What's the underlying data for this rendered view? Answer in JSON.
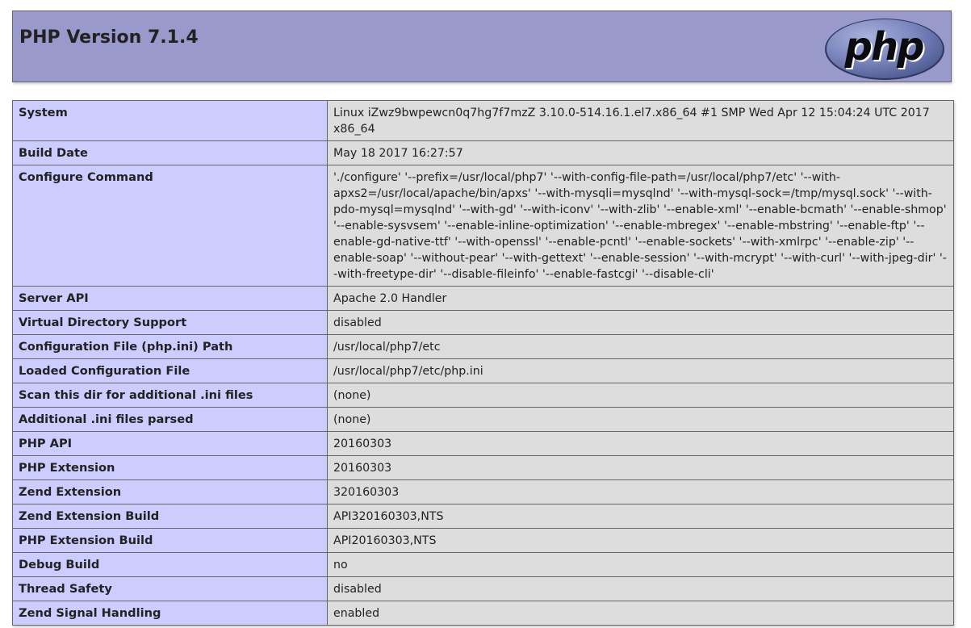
{
  "header": {
    "title": "PHP Version 7.1.4",
    "logo_text": "php",
    "colors": {
      "header_bg": "#9999cc",
      "key_cell_bg": "#ccccff",
      "value_cell_bg": "#dddddd",
      "logo_bg": "#6c78af"
    }
  },
  "rows": [
    {
      "key": "System",
      "value": "Linux iZwz9bwpewcn0q7hg7f7mzZ 3.10.0-514.16.1.el7.x86_64 #1 SMP Wed Apr 12 15:04:24 UTC 2017 x86_64"
    },
    {
      "key": "Build Date",
      "value": "May 18 2017 16:27:57"
    },
    {
      "key": "Configure Command",
      "value": "'./configure' '--prefix=/usr/local/php7' '--with-config-file-path=/usr/local/php7/etc' '--with-apxs2=/usr/local/apache/bin/apxs' '--with-mysqli=mysqlnd' '--with-mysql-sock=/tmp/mysql.sock' '--with-pdo-mysql=mysqlnd' '--with-gd' '--with-iconv' '--with-zlib' '--enable-xml' '--enable-bcmath' '--enable-shmop' '--enable-sysvsem' '--enable-inline-optimization' '--enable-mbregex' '--enable-mbstring' '--enable-ftp' '--enable-gd-native-ttf' '--with-openssl' '--enable-pcntl' '--enable-sockets' '--with-xmlrpc' '--enable-zip' '--enable-soap' '--without-pear' '--with-gettext' '--enable-session' '--with-mcrypt' '--with-curl' '--with-jpeg-dir' '--with-freetype-dir' '--disable-fileinfo' '--enable-fastcgi' '--disable-cli'"
    },
    {
      "key": "Server API",
      "value": "Apache 2.0 Handler"
    },
    {
      "key": "Virtual Directory Support",
      "value": "disabled"
    },
    {
      "key": "Configuration File (php.ini) Path",
      "value": "/usr/local/php7/etc"
    },
    {
      "key": "Loaded Configuration File",
      "value": "/usr/local/php7/etc/php.ini"
    },
    {
      "key": "Scan this dir for additional .ini files",
      "value": "(none)"
    },
    {
      "key": "Additional .ini files parsed",
      "value": "(none)"
    },
    {
      "key": "PHP API",
      "value": "20160303"
    },
    {
      "key": "PHP Extension",
      "value": "20160303"
    },
    {
      "key": "Zend Extension",
      "value": "320160303"
    },
    {
      "key": "Zend Extension Build",
      "value": "API320160303,NTS"
    },
    {
      "key": "PHP Extension Build",
      "value": "API20160303,NTS"
    },
    {
      "key": "Debug Build",
      "value": "no"
    },
    {
      "key": "Thread Safety",
      "value": "disabled"
    },
    {
      "key": "Zend Signal Handling",
      "value": "enabled"
    }
  ]
}
